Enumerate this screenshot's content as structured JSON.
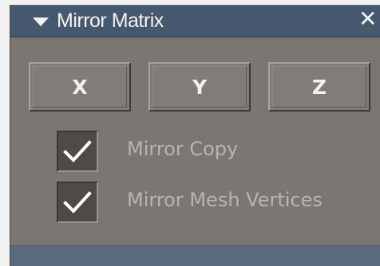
{
  "window": {
    "title": "Mirror Matrix",
    "collapse_icon": "triangle-down",
    "close_glyph": "✕"
  },
  "axis_buttons": [
    {
      "label": "X"
    },
    {
      "label": "Y"
    },
    {
      "label": "Z"
    }
  ],
  "options": [
    {
      "label": "Mirror Copy",
      "checked": true
    },
    {
      "label": "Mirror Mesh Vertices",
      "checked": true
    }
  ],
  "colors": {
    "titlebar": "#46586d",
    "panel": "#7c7673",
    "label_text": "#b9b4b1"
  }
}
